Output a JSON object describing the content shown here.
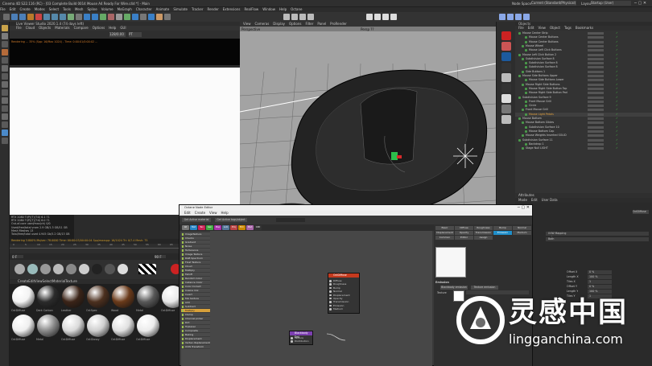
{
  "window": {
    "title": "Cinema 4D S22.116 (RC) - [03 Complete Build 0014 Mouse A4 Ready For Wire.c4d *] - Main",
    "node_space": "Node Space:",
    "node_space_value": "Current (Standard/Physical)",
    "layout_label": "Layout:",
    "layout_value": "Startup (User)"
  },
  "menubar": [
    "File",
    "Edit",
    "Create",
    "Modes",
    "Select",
    "Tools",
    "Mesh",
    "Spline",
    "Volume",
    "MoGraph",
    "Character",
    "Animate",
    "Simulate",
    "Tracker",
    "Render",
    "Extensions",
    "RealFlow",
    "Window",
    "Help",
    "Octane"
  ],
  "live_viewer": {
    "title": "Live Viewer Studio 2020.1.4 (74 days left)",
    "menu": [
      "File",
      "Cloud",
      "Objects",
      "Materials",
      "Compare",
      "Options",
      "Help",
      "GUI"
    ],
    "dropdown": "(Off)",
    "zoom": "128/0.00",
    "pt": "PT",
    "status": "Rendering ... 35% (Spp: 16/Max 1024)  - Time: 0:00:01/0:00:02  ..."
  },
  "stats": [
    "RTX 2080 Ti(P)(T)(T:0)  6.1  71",
    "RTX 2080 Ti(P)(T)(T:0)  6.0  71",
    "Out-of-core used/max(ch)  0/0",
    "Used/free/total vram  2.9 GB/1.3 GB/11 GB",
    "Mesh  Meshes  13",
    "Total/free/total used  4.945 Gb/5.2 GB/13 GB"
  ],
  "render_row": "Rendering 3.800%  Ms/sec: 78.0000  Time: 00:00:03/00:00:04  Spp/maxspp: 16/1024  Tri: 0/7.4 Mesh: 75",
  "timeline": {
    "fps": "0 F",
    "end": "90 F",
    "ticks": [
      "0",
      "5",
      "10",
      "15",
      "20",
      "25",
      "30",
      "35",
      "40",
      "45",
      "50",
      "55",
      "60",
      "65",
      "70",
      "75",
      "80",
      "85",
      "90"
    ]
  },
  "mat_menu": [
    "Create",
    "Edit",
    "View",
    "Select",
    "Material",
    "Texture"
  ],
  "materials": [
    {
      "name": "OctDiffuse",
      "color": "#f3f3f3"
    },
    {
      "name": "Dark Carbon",
      "color": "#2b2b2b"
    },
    {
      "name": "Leather",
      "color": "#3b2418"
    },
    {
      "name": "OctSpec",
      "color": "#4c301f"
    },
    {
      "name": "Wood",
      "color": "#6a3a1a"
    },
    {
      "name": "Metal",
      "color": "#585858"
    },
    {
      "name": "OctDiffuse",
      "color": "#e8e8e8"
    },
    {
      "name": "Rubber",
      "color": "#373737"
    },
    {
      "name": "OctGlossy",
      "color": "#d8d8d8"
    },
    {
      "name": "OctDiffuse",
      "color": "#efefef"
    },
    {
      "name": "Metal",
      "color": "#8a8a8a"
    },
    {
      "name": "OctDiffuse",
      "color": "#dadada"
    },
    {
      "name": "OctGlossy",
      "color": "#cfcfcf"
    },
    {
      "name": "OctDiffuse",
      "color": "#e0e0e0"
    },
    {
      "name": "OctDiffuse",
      "color": "#ececec"
    }
  ],
  "viewport": {
    "menu": [
      "View",
      "Cameras",
      "Display",
      "Options",
      "Filter",
      "Panel",
      "ProRender"
    ],
    "label": "Perspective",
    "camera": "Persp ??"
  },
  "objects": {
    "header": "Objects",
    "menu": [
      "File",
      "Edit",
      "View",
      "Object",
      "Tags",
      "Bookmarks"
    ],
    "rows": [
      "Mouse Center Strip",
      "Mouse Center Buttons",
      "Mouse Center Buttons",
      "Mouse Wheel",
      "Mouse Left Click Buttons",
      "Mouse Left Click Button 2",
      "Subdivision Surface 8",
      "Subdivision Surface 8",
      "Subdivision Surface 8",
      "Side Buttons 1",
      "Mouse Side Buttons Upper",
      "Mouse Side Buttons Lower",
      "Mouse Right Side Buttons",
      "Mouse Right Side Button Top",
      "Mouse Right Side Button Pad",
      "Subdivision Surface 9",
      "Front Mouse Grill",
      "Circle",
      "Front Mouse Grill",
      "Mouse Light Petals",
      "Mouse Bottom",
      "Mouse Bottom Glides",
      "Subdivision Surface 10",
      "Mouse Bottom Cap",
      "Mouse Weights Inserted SOLID",
      "Subdivision Surface 11",
      "Backdrop 1",
      "Stage Null LIGHT"
    ]
  },
  "attributes": {
    "header": "Attributes",
    "menu": [
      "Mode",
      "Edit",
      "User Data"
    ],
    "rows": [
      {
        "label": "Offset X",
        "value": "0 %"
      },
      {
        "label": "Length X",
        "value": "100 %"
      },
      {
        "label": "Tiles X",
        "value": "1"
      },
      {
        "label": "Offset Y",
        "value": "0 %"
      },
      {
        "label": "Length Y",
        "value": "100 %"
      },
      {
        "label": "Tiles Y",
        "value": "1"
      }
    ],
    "tex_label": "Texture",
    "proj_label": "Projection",
    "proj_value": "UVW Mapping",
    "side_value": "Both",
    "tab_label": "OctDiffuse"
  },
  "node_editor": {
    "title": "Octane Node Editor",
    "menu": [
      "Edit",
      "Create",
      "View",
      "Help"
    ],
    "get_active": "Get Active material",
    "get_active_tags": "Get Active tags/object",
    "categories": [
      "All",
      "Mat",
      "Tex",
      "Gen",
      "Map",
      "Lum",
      "Proj",
      "Emi",
      "Med",
      "C4D"
    ],
    "list": [
      "ImageTexture",
      "Checks",
      "Gradient",
      "Noise",
      "Turbulence",
      "Image Texture",
      "RGB Spectrum",
      "Float Texture",
      "Cloud",
      "Multiply",
      "Falloff",
      "Random Color",
      "Instance Color",
      "Color Correct",
      "Cosine mix",
      "Invert",
      "Mix texture",
      "Add",
      "Subtract",
      "Multiply",
      "Clamp",
      "Channel picker",
      "Dirt",
      "Triplanar",
      "Composite",
      "Baking",
      "Displacement",
      "Vertex displacement",
      "UVW Transform"
    ],
    "main_node": {
      "title": "OctDiffuse",
      "pins": [
        "Diffuse",
        "Roughness",
        "Bump",
        "Normal",
        "Displacement",
        "Opacity",
        "Transmission",
        "Emission",
        "Medium"
      ]
    },
    "small_node": {
      "title": "Blackbody Emi",
      "pins": [
        "Texture",
        "Distribution"
      ]
    },
    "tabs": [
      "Basic",
      "Diffuse",
      "Roughness",
      "Bump",
      "Normal",
      "Displacement",
      "Opacity",
      "Transmission",
      "Emission",
      "Medium",
      "Common",
      "Editor",
      "Assign"
    ],
    "section": "Emission",
    "bb_btn": "Blackbody emission",
    "tex_btn": "Texture emission",
    "tex_label": "Texture"
  },
  "watermark": {
    "cn": "灵感中国",
    "url": "lingganchina.com"
  }
}
